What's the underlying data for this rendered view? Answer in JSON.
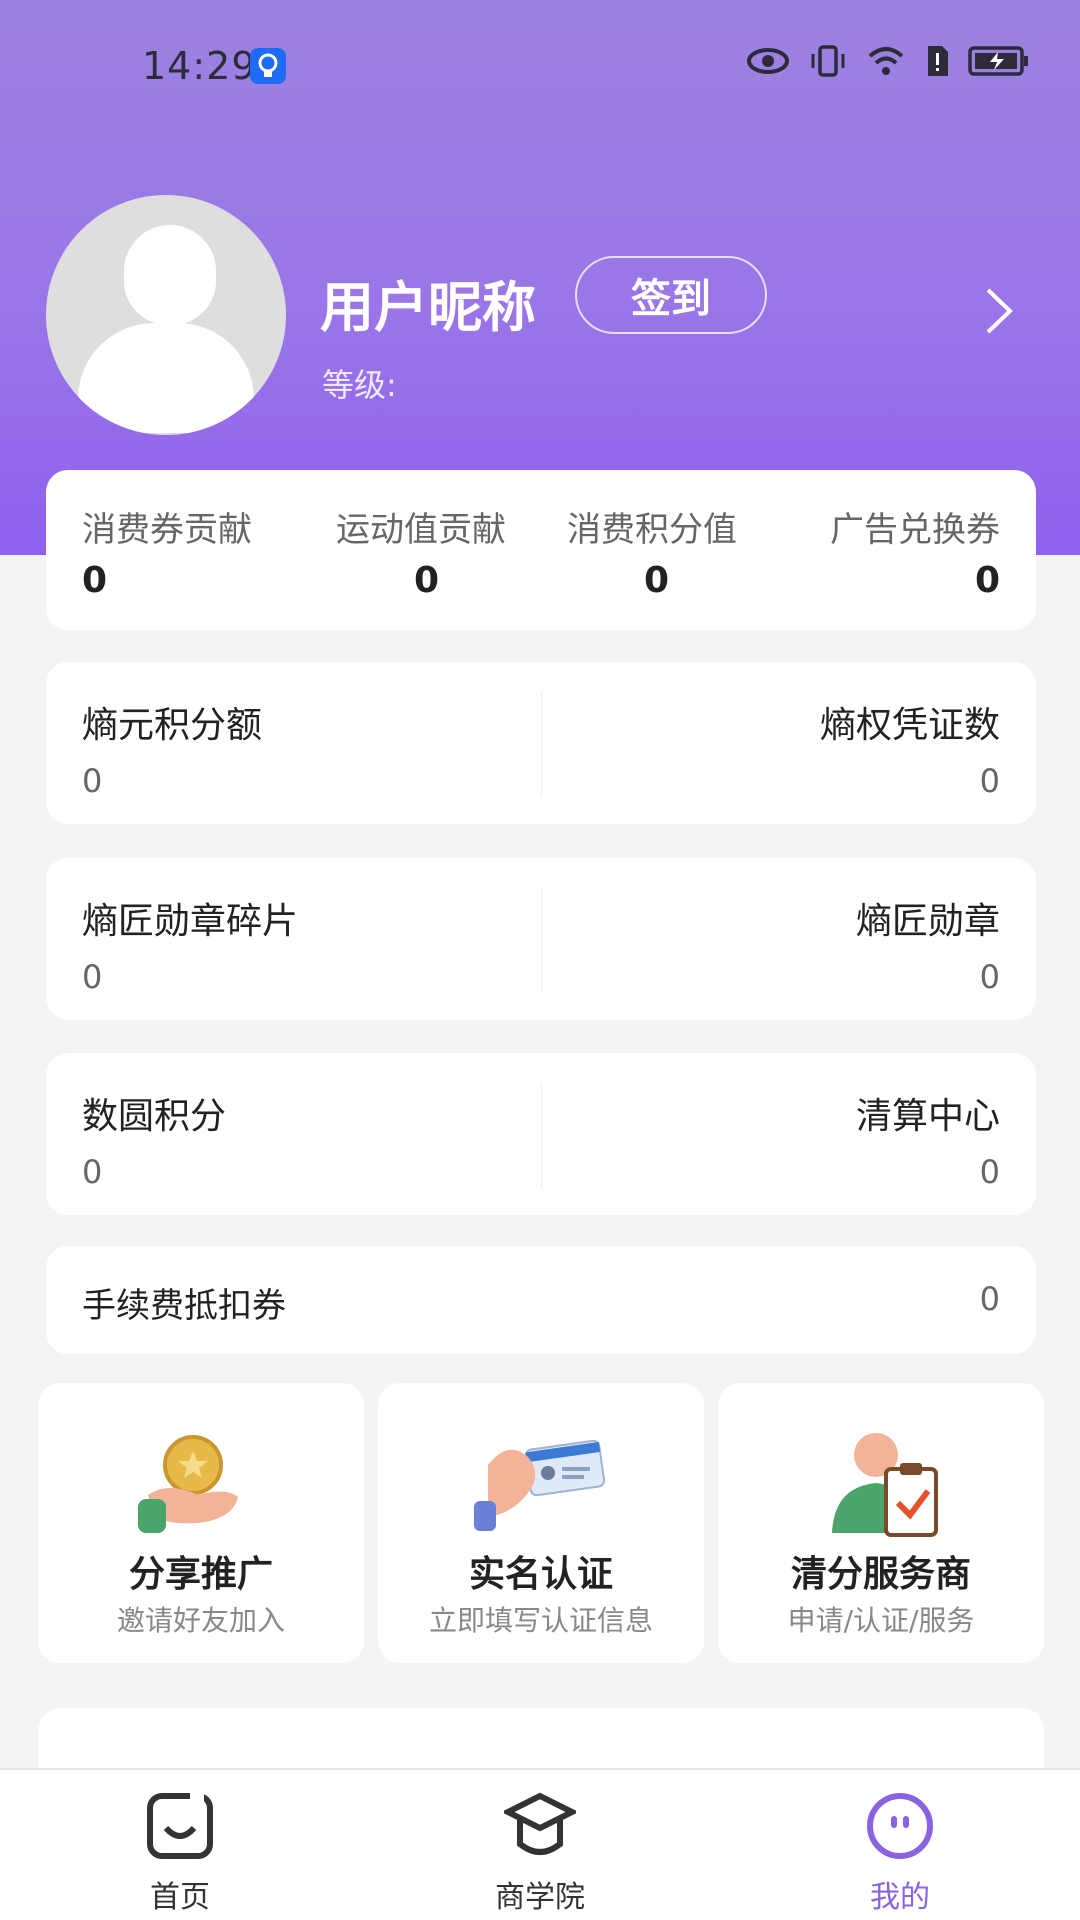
{
  "status_bar": {
    "time": "14:29"
  },
  "profile": {
    "nickname": "用户昵称",
    "signin_label": "签到",
    "level_label": "等级:"
  },
  "stats": [
    {
      "label": "消费券贡献",
      "value": "0"
    },
    {
      "label": "运动值贡献",
      "value": "0"
    },
    {
      "label": "消费积分值",
      "value": "0"
    },
    {
      "label": "广告兑换券",
      "value": "0"
    }
  ],
  "pairs": [
    {
      "left_label": "熵元积分额",
      "left_value": "0",
      "right_label": "熵权凭证数",
      "right_value": "0"
    },
    {
      "left_label": "熵匠勋章碎片",
      "left_value": "0",
      "right_label": "熵匠勋章",
      "right_value": "0"
    },
    {
      "left_label": "数圆积分",
      "left_value": "0",
      "right_label": "清算中心",
      "right_value": "0"
    }
  ],
  "fee_voucher": {
    "label": "手续费抵扣券",
    "value": "0"
  },
  "features": [
    {
      "title": "分享推广",
      "subtitle": "邀请好友加入",
      "icon": "coin-hand-icon"
    },
    {
      "title": "实名认证",
      "subtitle": "立即填写认证信息",
      "icon": "id-card-hand-icon"
    },
    {
      "title": "清分服务商",
      "subtitle": "申请/认证/服务",
      "icon": "person-clipboard-icon"
    }
  ],
  "nav": [
    {
      "label": "首页",
      "icon": "home-icon",
      "active": false
    },
    {
      "label": "商学院",
      "icon": "graduation-cap-icon",
      "active": false
    },
    {
      "label": "我的",
      "icon": "profile-face-icon",
      "active": true
    }
  ],
  "colors": {
    "header_gradient_top": "#9b82df",
    "header_gradient_bottom": "#9060ee",
    "accent": "#8a63e0",
    "background": "#f4f4f6"
  }
}
